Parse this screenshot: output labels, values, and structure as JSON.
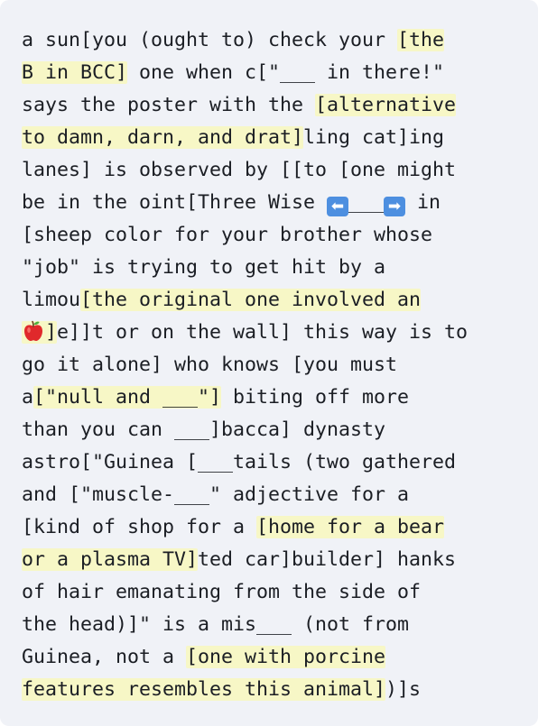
{
  "segments": {
    "l1a": "a sun[you (ought to) check your ",
    "l1h": "[the",
    "l2h": "B in BCC]",
    "l2b": " one when c[\"___ in there!\"",
    "l3a": "says the poster with the ",
    "l3h": "[alternative",
    "l4h": "to damn, darn, and drat]",
    "l4b": "ling cat]ing",
    "l5": "lanes] is observed by [[to [one might",
    "l6a": "be in the oint[Three Wise ",
    "l6b": "___",
    "l6c": " in",
    "l7": "[sheep color for your brother whose",
    "l8": "\"job\" is trying to get hit by a",
    "l9a": "limou",
    "l9h": "[the original one involved an",
    "l10h": "]",
    "l10b": "e]]t or on the wall] this way is to",
    "l11": "go it alone] who knows [you must",
    "l12a": "a",
    "l12h": "[\"null and ___\"]",
    "l12b": " biting off more",
    "l13": "than you can ___]bacca] dynasty",
    "l14": "astro[\"Guinea [___tails (two gathered",
    "l15": "and [\"muscle-___\" adjective for a",
    "l16a": "[kind of shop for a ",
    "l16h": "[home for a bear",
    "l17h": "or a plasma TV]",
    "l17b": "ted car]builder] hanks",
    "l18": "of hair emanating from the side of",
    "l19": "the head)]\" is a mis___ (not from",
    "l20a": "Guinea, not a ",
    "l20h": "[one with porcine",
    "l21h": "features resembles this animal]",
    "l21b": ")]s"
  },
  "icons": {
    "left_arrow": "⬅",
    "right_arrow": "➡",
    "apple": "apple-emoji"
  },
  "colors": {
    "background": "#f0f2f7",
    "highlight": "#f7f7c6",
    "text": "#1b1e24",
    "arrow_box": "#4d8fe0",
    "apple": "#e0292b"
  }
}
